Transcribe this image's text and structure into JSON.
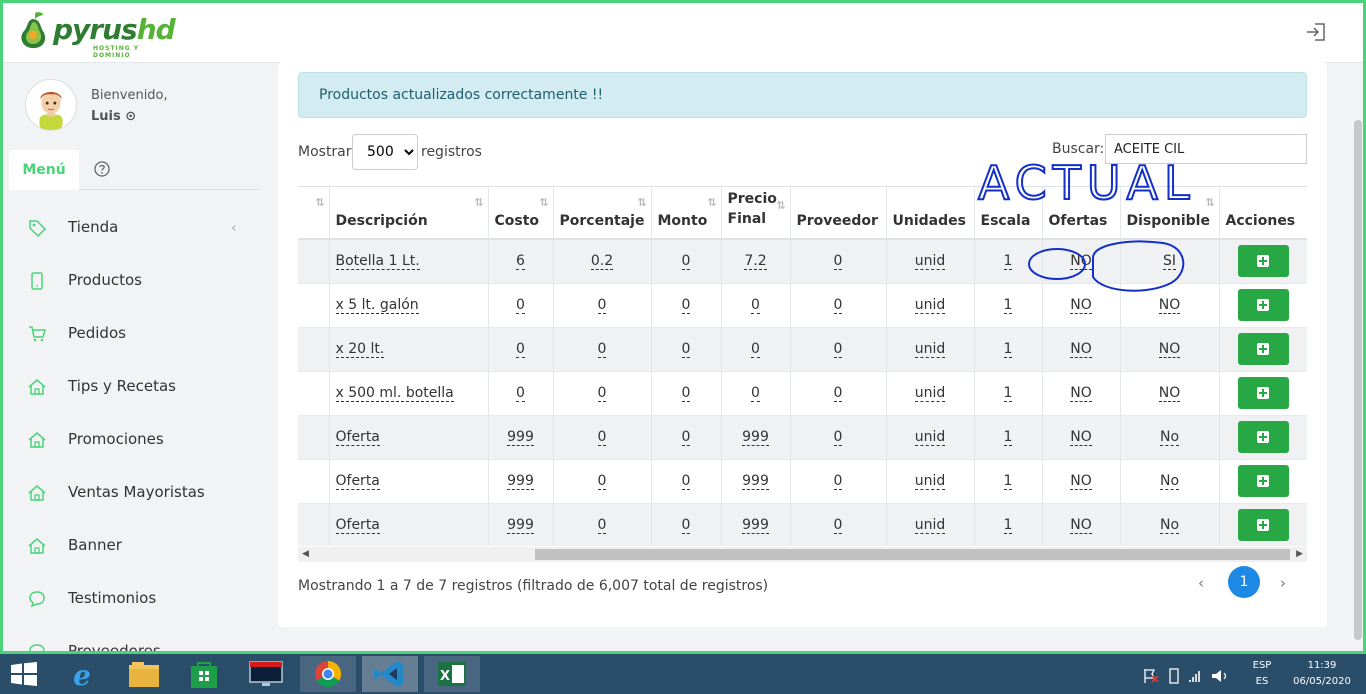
{
  "brand": {
    "name_dark": "pyrus",
    "name_light": "hd",
    "tagline": "HOSTING Y DOMINIO"
  },
  "user": {
    "welcome": "Bienvenido,",
    "name": "Luis ⊙"
  },
  "menu": {
    "tab_label": "Menú"
  },
  "sidebar": {
    "items": [
      {
        "label": "Tienda",
        "icon": "tag-icon"
      },
      {
        "label": "Productos",
        "icon": "phone-icon"
      },
      {
        "label": "Pedidos",
        "icon": "cart-icon"
      },
      {
        "label": "Tips y Recetas",
        "icon": "home-icon"
      },
      {
        "label": "Promociones",
        "icon": "home-icon"
      },
      {
        "label": "Ventas Mayoristas",
        "icon": "home-icon"
      },
      {
        "label": "Banner",
        "icon": "home-icon"
      },
      {
        "label": "Testimonios",
        "icon": "chat-icon"
      },
      {
        "label": "Proveedores",
        "icon": "chat-icon"
      }
    ]
  },
  "alert": {
    "message": "Productos actualizados correctamente !!"
  },
  "table_controls": {
    "show_label": "Mostrar",
    "page_length": "500",
    "records_label": "registros",
    "search_label": "Buscar:",
    "search_value": "ACEITE CIL"
  },
  "table": {
    "headers": [
      "",
      "Descripción",
      "Costo",
      "Porcentaje",
      "Monto",
      "Precio Final",
      "Proveedor",
      "Unidades",
      "Escala",
      "Ofertas",
      "Disponible",
      "Acciones"
    ],
    "rows": [
      [
        "",
        "Botella 1 Lt.",
        "6",
        "0.2",
        "0",
        "7.2",
        "0",
        "unid",
        "1",
        "NO",
        "SI"
      ],
      [
        "",
        "x 5 lt. galón",
        "0",
        "0",
        "0",
        "0",
        "0",
        "unid",
        "1",
        "NO",
        "NO"
      ],
      [
        "",
        "x 20 lt.",
        "0",
        "0",
        "0",
        "0",
        "0",
        "unid",
        "1",
        "NO",
        "NO"
      ],
      [
        "",
        "x 500 ml. botella",
        "0",
        "0",
        "0",
        "0",
        "0",
        "unid",
        "1",
        "NO",
        "NO"
      ],
      [
        "",
        "Oferta",
        "999",
        "0",
        "0",
        "999",
        "0",
        "unid",
        "1",
        "NO",
        "No"
      ],
      [
        "",
        "Oferta",
        "999",
        "0",
        "0",
        "999",
        "0",
        "unid",
        "1",
        "NO",
        "No"
      ],
      [
        "",
        "Oferta",
        "999",
        "0",
        "0",
        "999",
        "0",
        "unid",
        "1",
        "NO",
        "No"
      ]
    ]
  },
  "footer": {
    "info": "Mostrando 1 a 7 de 7 registros (filtrado de 6,007 total de registros)",
    "current_page": "1",
    "prev": "‹",
    "next": "›"
  },
  "annotation": {
    "text": "ACTUAL"
  },
  "taskbar": {
    "apps": [
      "internet-explorer-icon",
      "file-explorer-icon",
      "store-icon",
      "lenovo-icon",
      "chrome-icon",
      "vscode-icon",
      "excel-icon"
    ],
    "lang_top": "ESP",
    "lang_bottom": "ES",
    "time": "11:39",
    "date": "06/05/2020"
  },
  "colors": {
    "accent": "#4bd37a",
    "button": "#28a745",
    "page_btn": "#1e88e5",
    "alert_bg": "#d2ecf1",
    "ink": "#1330c8"
  }
}
